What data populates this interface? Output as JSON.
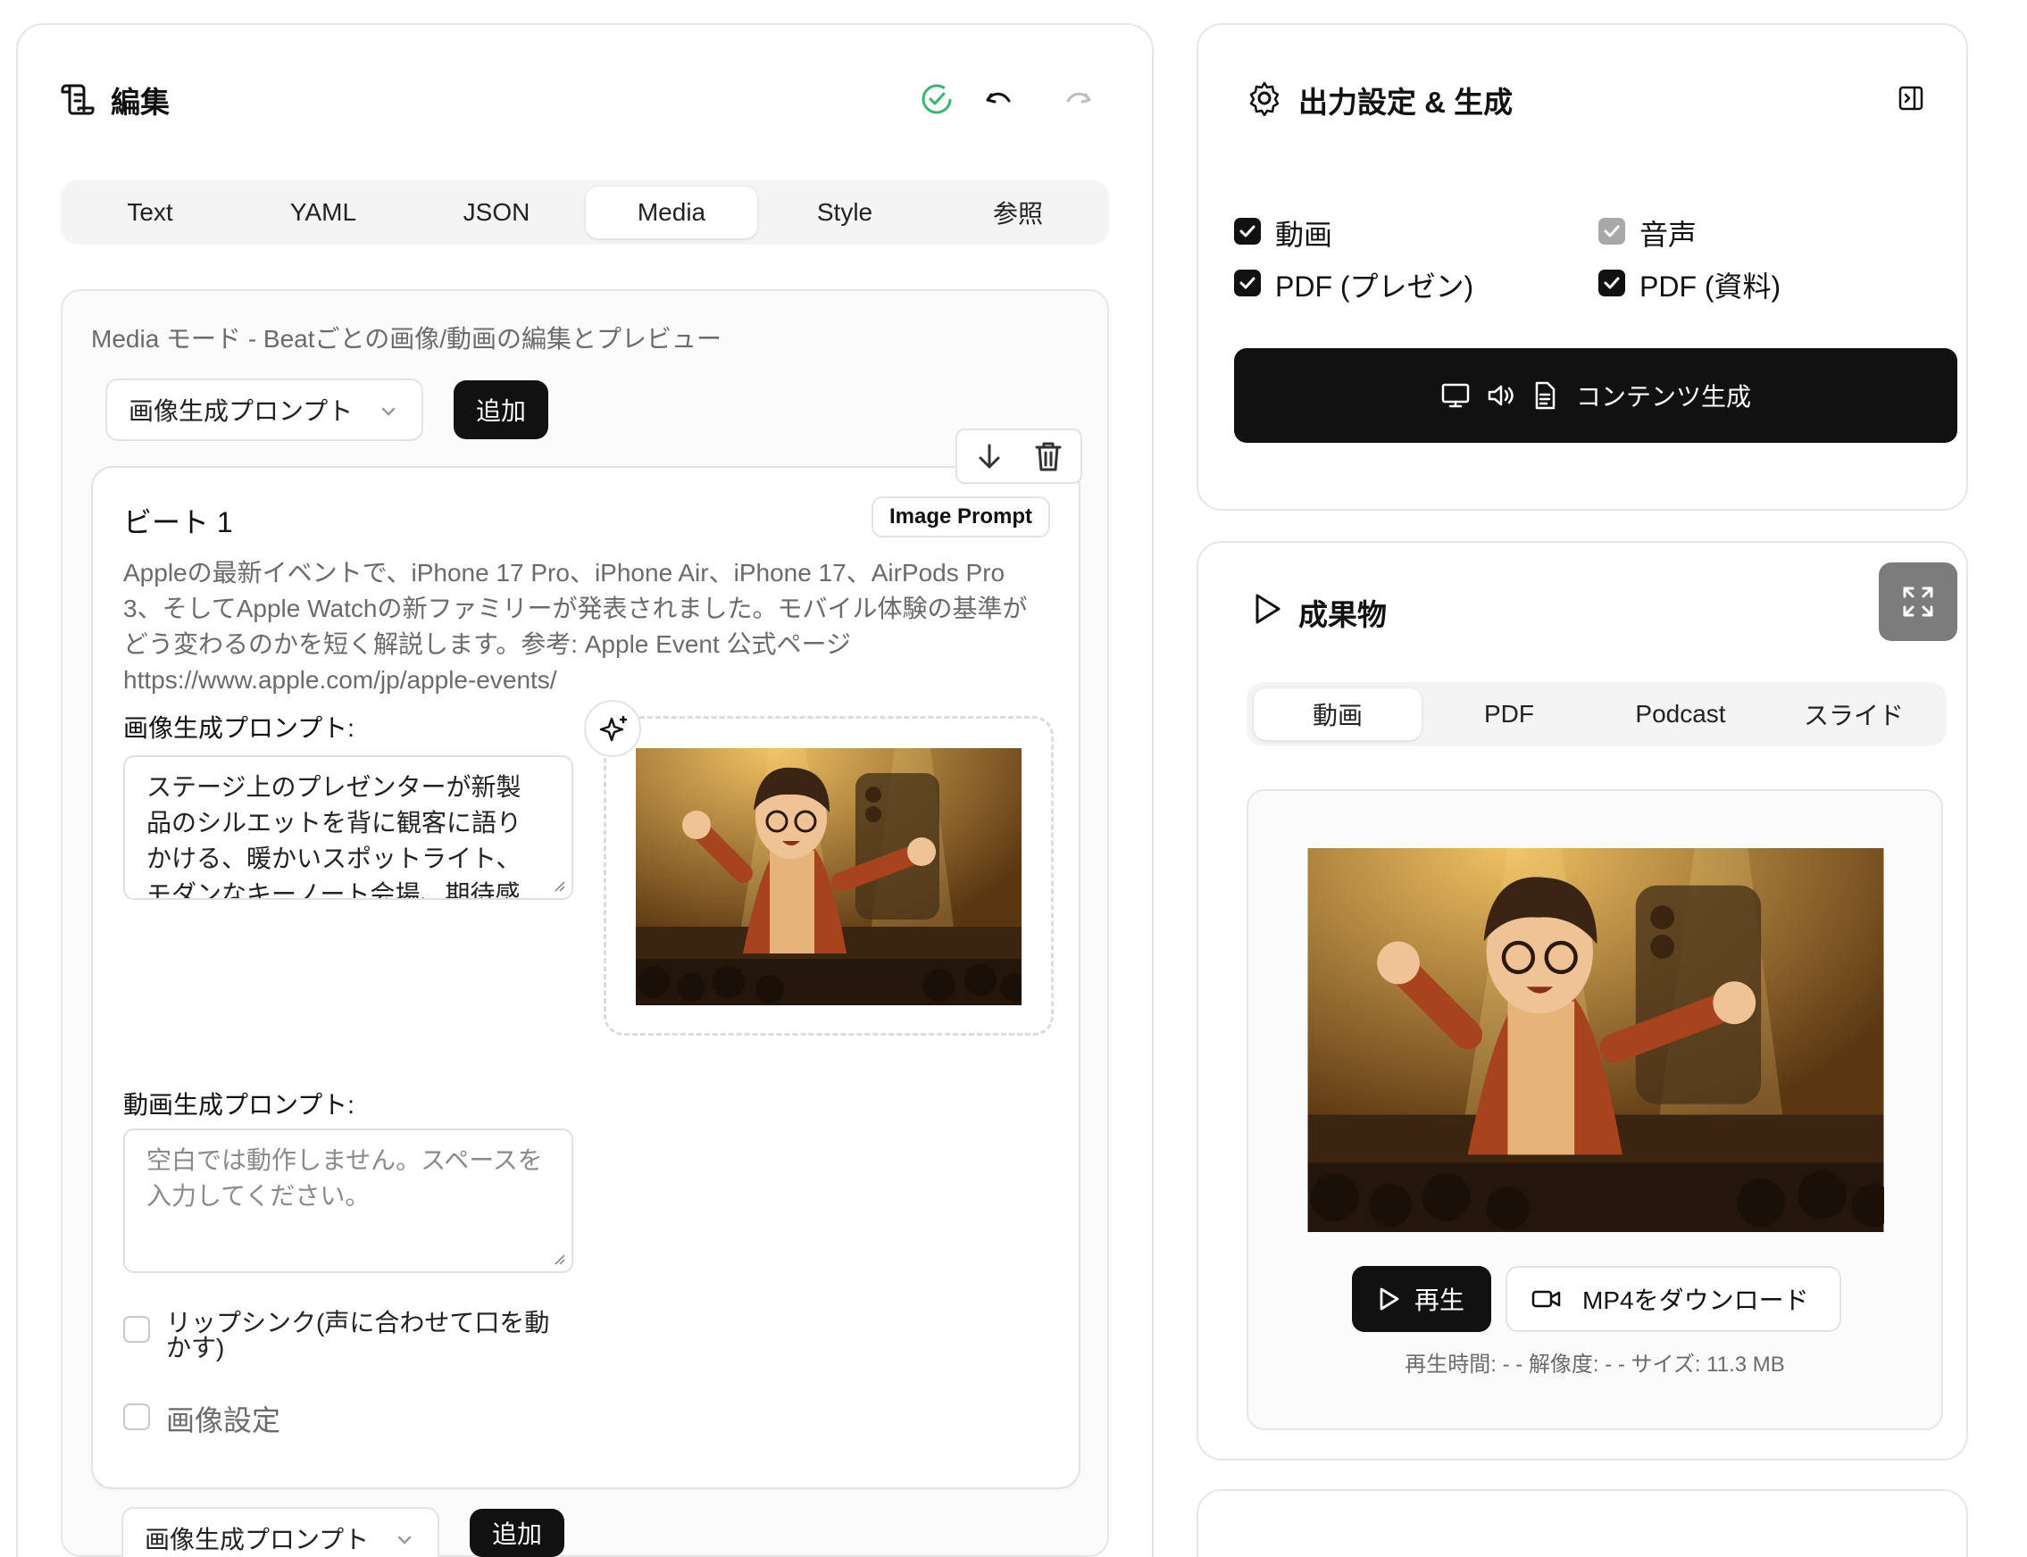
{
  "editor": {
    "title": "編集",
    "tabs": [
      "Text",
      "YAML",
      "JSON",
      "Media",
      "Style",
      "参照"
    ],
    "active_tab": "Media",
    "media": {
      "description": "Media モード - Beatごとの画像/動画の編集とプレビュー",
      "type_select": "画像生成プロンプト",
      "add_label": "追加",
      "beat": {
        "title": "ビート 1",
        "badge": "Image Prompt",
        "text_lines": [
          "Appleの最新イベントで、iPhone 17 Pro、iPhone Air、iPhone 17、AirPods Pro",
          "3、そしてApple Watchの新ファミリーが発表されました。モバイル体験の基準が",
          "どう変わるのかを短く解説します。参考: Apple Event 公式ページ",
          "https://www.apple.com/jp/apple-events/"
        ],
        "image_prompt_label": "画像生成プロンプト:",
        "image_prompt_lines": [
          "ステージ上のプレゼンターが新製",
          "品のシルエットを背に観客に語り",
          "かける、暖かいスポットライト、",
          "モダンなキーノート会場、期待感"
        ],
        "video_prompt_label": "動画生成プロンプト:",
        "video_prompt_placeholder_lines": [
          "空白では動作しません。スペースを",
          "入力してください。"
        ],
        "lipsync_label_lines": [
          "リップシンク(声に合わせて口を動",
          "かす)"
        ],
        "image_settings_label": "画像設定"
      },
      "next_select": "画像生成プロンプト",
      "next_add_label": "追加"
    }
  },
  "output": {
    "title": "出力設定 & 生成",
    "options": [
      {
        "label": "動画",
        "checked": true
      },
      {
        "label": "音声",
        "checked": true,
        "disabled": true
      },
      {
        "label": "PDF (プレゼン)",
        "checked": true
      },
      {
        "label": "PDF (資料)",
        "checked": true
      }
    ],
    "generate_label": "コンテンツ生成"
  },
  "result": {
    "title": "成果物",
    "tabs": [
      "動画",
      "PDF",
      "Podcast",
      "スライド"
    ],
    "active_tab": "動画",
    "play_label": "再生",
    "download_label": "MP4をダウンロード",
    "meta": "再生時間: - - 解像度: - - サイズ: 11.3 MB"
  },
  "colors": {
    "accent_dark": "#111111",
    "success_green": "#3cb371",
    "panel_border": "#e6e6e6",
    "scene_warm": "#c98a2e"
  },
  "icons": [
    "list-edit-icon",
    "check-circle-icon",
    "undo-icon",
    "redo-icon",
    "gear-icon",
    "sidebar-collapse-icon",
    "monitor-icon",
    "speaker-icon",
    "document-icon",
    "play-icon",
    "expand-icon",
    "video-camera-icon",
    "arrow-down-icon",
    "trash-icon",
    "sparkle-icon",
    "chevron-down-icon"
  ]
}
